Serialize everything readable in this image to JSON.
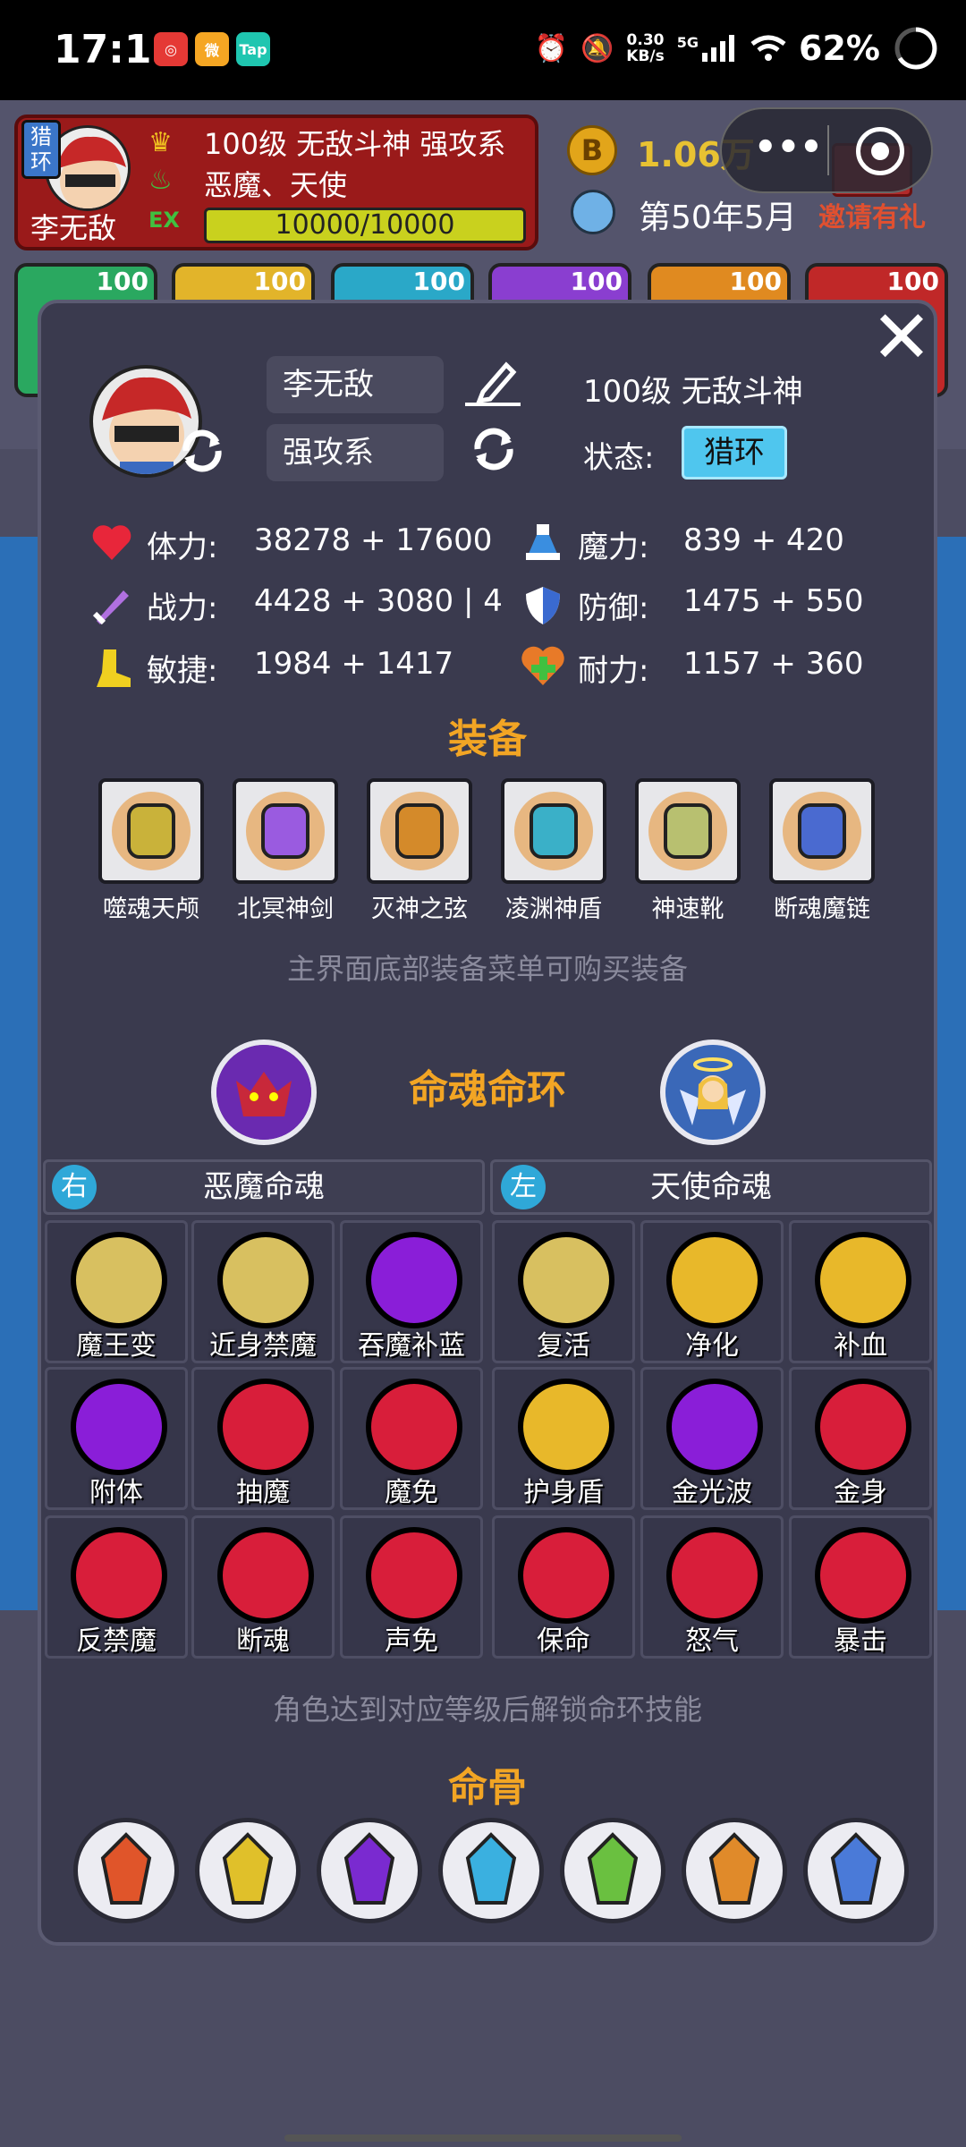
{
  "status_bar": {
    "time": "17:13",
    "net_speed": "0.30",
    "net_unit": "KB/s",
    "gen": "5G",
    "battery": "62%",
    "apps": [
      {
        "label": "◎",
        "color": "#e53935"
      },
      {
        "label": "微",
        "color": "#f5a623"
      },
      {
        "label": "Tap",
        "color": "#1fc6b0"
      }
    ]
  },
  "background": {
    "hero_tag": "猎\n环",
    "hero_name": "李无敌",
    "hero_line1": "100级 无敌斗神 强攻系",
    "hero_line2": "恶魔、天使",
    "exp_label": "EX",
    "xp": "10000/10000",
    "coin_symbol": "B",
    "coin": "1.06万",
    "date": "第50年5月",
    "invite": "邀请有礼",
    "slots": [
      {
        "level": "100",
        "color": "#2aa860"
      },
      {
        "level": "100",
        "color": "#e2b42a"
      },
      {
        "level": "100",
        "color": "#2aa8c8"
      },
      {
        "level": "100",
        "color": "#8a3ed0"
      },
      {
        "level": "100",
        "color": "#e08a20"
      },
      {
        "level": "100",
        "color": "#c02828"
      }
    ]
  },
  "panel": {
    "close_label": "✕",
    "name": "李无敌",
    "type": "强攻系",
    "level_title": "100级 无敌斗神",
    "state_label": "状态:",
    "state_value": "猎环",
    "stats": [
      {
        "icon": "heart-icon",
        "label": "体力:",
        "value": "38278 + 17600"
      },
      {
        "icon": "potion-icon",
        "label": "魔力:",
        "value": "839 + 420"
      },
      {
        "icon": "sword-icon",
        "label": "战力:",
        "value": "4428 + 3080 | 4"
      },
      {
        "icon": "shield-icon",
        "label": "防御:",
        "value": "1475 + 550"
      },
      {
        "icon": "boot-icon",
        "label": "敏捷:",
        "value": "1984 + 1417"
      },
      {
        "icon": "health-plus-icon",
        "label": "耐力:",
        "value": "1157 + 360"
      }
    ],
    "equip_title": "装备",
    "equipment": [
      {
        "name": "噬魂天颅",
        "color": "#c9b23a"
      },
      {
        "name": "北冥神剑",
        "color": "#9a5be0"
      },
      {
        "name": "灭神之弦",
        "color": "#d48a2a"
      },
      {
        "name": "凌渊神盾",
        "color": "#3ab0c8"
      },
      {
        "name": "神速靴",
        "color": "#b8c070"
      },
      {
        "name": "断魂魔链",
        "color": "#4a6ad0"
      }
    ],
    "equip_hint": "主界面底部装备菜单可购买装备",
    "soul_title": "命魂命环",
    "demon_side": "右",
    "demon_title": "恶魔命魂",
    "angel_side": "左",
    "angel_title": "天使命魂",
    "skills": [
      [
        {
          "name": "魔王变",
          "color": "#d8c060"
        },
        {
          "name": "近身禁魔",
          "color": "#d8c060"
        },
        {
          "name": "吞魔补蓝",
          "color": "#8a1ed8"
        },
        {
          "name": "复活",
          "color": "#d8c060"
        },
        {
          "name": "净化",
          "color": "#e8b82a"
        },
        {
          "name": "补血",
          "color": "#e8b82a"
        }
      ],
      [
        {
          "name": "附体",
          "color": "#8a1ed8"
        },
        {
          "name": "抽魔",
          "color": "#d81e3a"
        },
        {
          "name": "魔免",
          "color": "#d81e3a"
        },
        {
          "name": "护身盾",
          "color": "#e8b82a"
        },
        {
          "name": "金光波",
          "color": "#8a1ed8"
        },
        {
          "name": "金身",
          "color": "#d81e3a"
        }
      ],
      [
        {
          "name": "反禁魔",
          "color": "#d81e3a"
        },
        {
          "name": "断魂",
          "color": "#d81e3a"
        },
        {
          "name": "声免",
          "color": "#d81e3a"
        },
        {
          "name": "保命",
          "color": "#d81e3a"
        },
        {
          "name": "怒气",
          "color": "#d81e3a"
        },
        {
          "name": "暴击",
          "color": "#d81e3a"
        }
      ]
    ],
    "skill_hint": "角色达到对应等级后解锁命环技能",
    "bone_title": "命骨",
    "bones": [
      {
        "color": "#e0552a"
      },
      {
        "color": "#e0c02a"
      },
      {
        "color": "#7a2ad0"
      },
      {
        "color": "#3ab0e0"
      },
      {
        "color": "#6ac040"
      },
      {
        "color": "#e08a2a"
      },
      {
        "color": "#4a7ad8"
      }
    ]
  }
}
